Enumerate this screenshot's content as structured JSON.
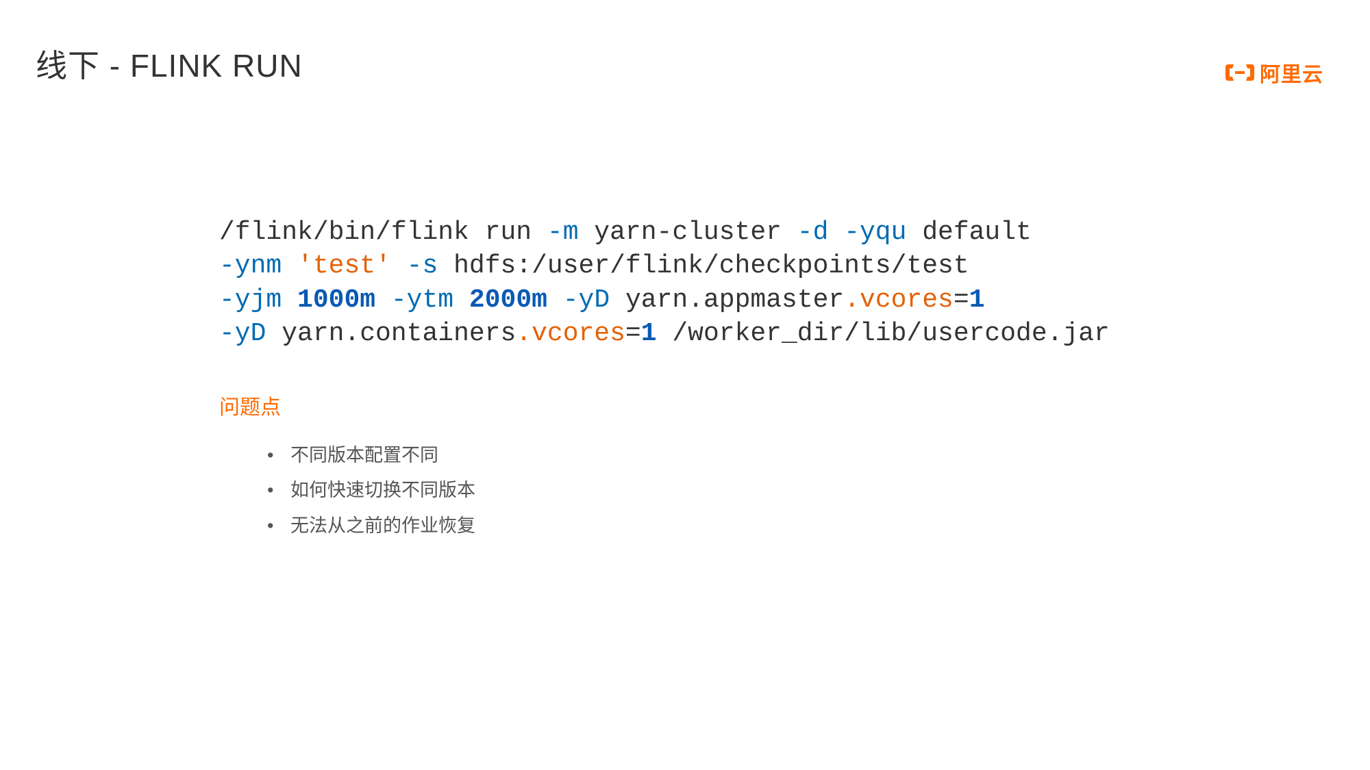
{
  "title": "线下 - FLINK RUN",
  "logo": {
    "text": "阿里云"
  },
  "code": {
    "l1": {
      "a": "/flink/bin/flink run ",
      "m": "-m",
      "b": " yarn-cluster ",
      "d": "-d",
      "sp1": " ",
      "yqu": "-yqu",
      "c": " default"
    },
    "l2": {
      "ynm": "-ynm",
      "sp": " ",
      "str": "'test'",
      "sp2": " ",
      "s": "-s",
      "rest": " hdfs:/user/flink/checkpoints/test"
    },
    "l3": {
      "yjm": "-yjm",
      "sp1": " ",
      "n1": "1000m",
      "sp2": " ",
      "ytm": "-ytm",
      "sp3": " ",
      "n2": "2000m",
      "sp4": " ",
      "yd": "-yD",
      "sp5": " yarn.appmaster",
      "dot": ".vcores",
      "eq": "=",
      "v": "1"
    },
    "l4": {
      "yd": "-yD",
      "sp1": " yarn.containers",
      "dot": ".vcores",
      "eq": "=",
      "v": "1",
      "rest": " /worker_dir/lib/usercode.jar"
    }
  },
  "issues": {
    "heading": "问题点",
    "items": [
      "不同版本配置不同",
      "如何快速切换不同版本",
      "无法从之前的作业恢复"
    ]
  }
}
